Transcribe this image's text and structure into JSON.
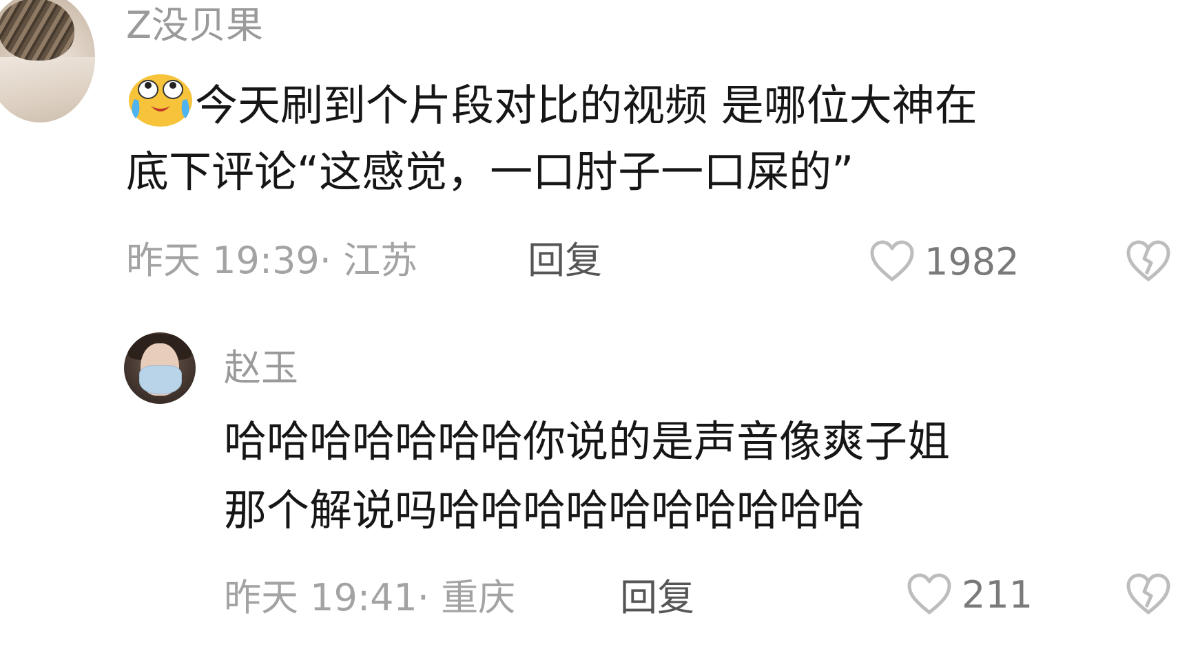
{
  "comments": [
    {
      "username": "Z没贝果",
      "line1": "今天刷到个片段对比的视频 是哪位大神在",
      "line2": "底下评论“这感觉，一口肘子一口屎的”",
      "meta": "昨天 19:39· 江苏",
      "reply_label": "回复",
      "likes": "1982",
      "emoji_icon": "crying-laughing-emoji-icon",
      "avatar_icon": "cat-avatar"
    },
    {
      "username": "赵玉",
      "line1": "哈哈哈哈哈哈哈你说的是声音像爽子姐",
      "line2": "那个解说吗哈哈哈哈哈哈哈哈哈哈",
      "meta": "昨天 19:41· 重庆",
      "reply_label": "回复",
      "likes": "211",
      "avatar_icon": "masked-woman-avatar"
    }
  ],
  "colors": {
    "text": "#161616",
    "muted": "#a3a3a3",
    "reply": "#555555",
    "icon": "#bdbdbd"
  }
}
